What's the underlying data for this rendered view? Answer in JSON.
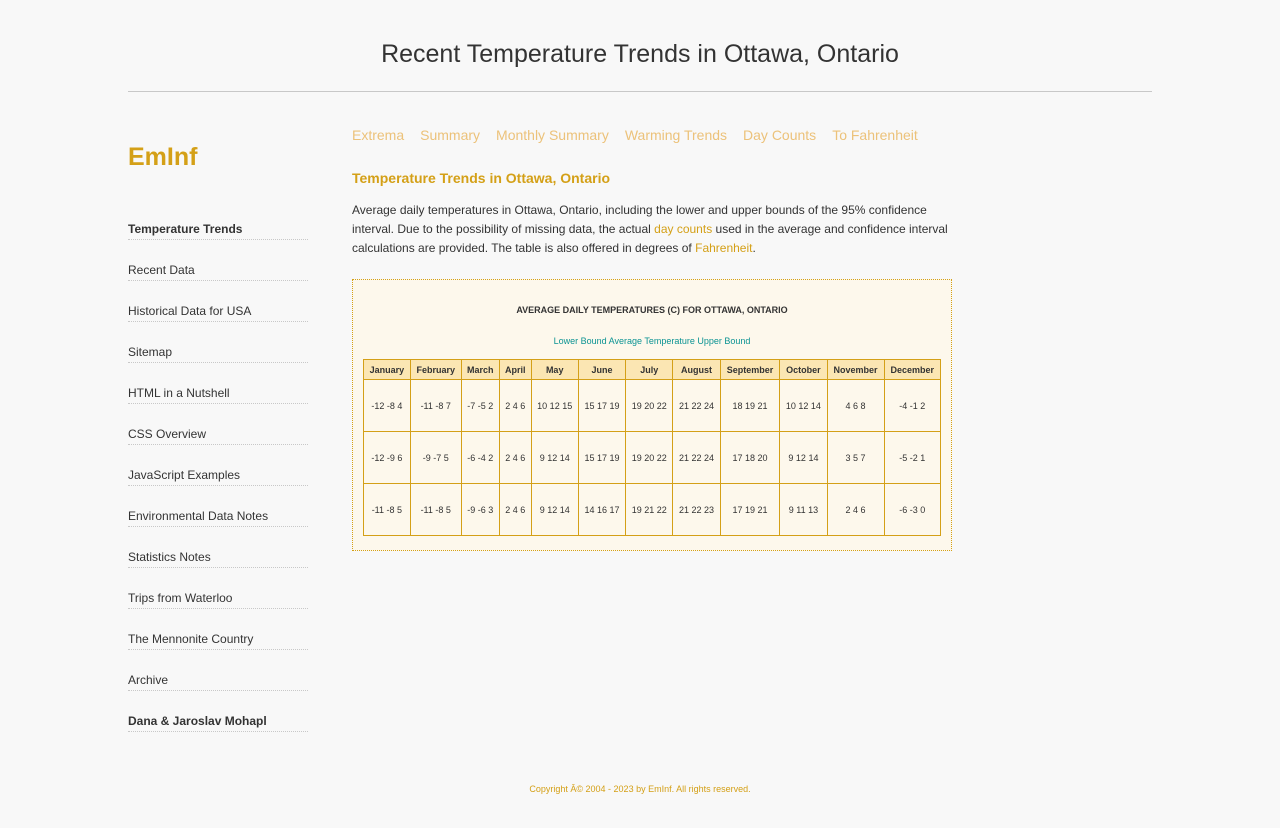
{
  "page_title": "Recent Temperature Trends in Ottawa, Ontario",
  "logo": "EmInf",
  "sidebar": {
    "items": [
      {
        "label": "Temperature Trends",
        "bold": true
      },
      {
        "label": "Recent Data",
        "bold": false
      },
      {
        "label": "Historical Data for USA",
        "bold": false
      },
      {
        "label": "Sitemap",
        "bold": false
      },
      {
        "label": "HTML in a Nutshell",
        "bold": false
      },
      {
        "label": "CSS Overview",
        "bold": false
      },
      {
        "label": "JavaScript Examples",
        "bold": false
      },
      {
        "label": "Environmental Data Notes",
        "bold": false
      },
      {
        "label": "Statistics Notes",
        "bold": false
      },
      {
        "label": "Trips from Waterloo",
        "bold": false
      },
      {
        "label": "The Mennonite Country",
        "bold": false
      },
      {
        "label": "Archive",
        "bold": false
      },
      {
        "label": "Dana & Jaroslav Mohapl",
        "bold": true
      }
    ]
  },
  "topnav": {
    "items": [
      "Extrema",
      "Summary",
      "Monthly Summary",
      "Warming Trends",
      "Day Counts",
      "To Fahrenheit"
    ]
  },
  "main": {
    "heading": "Temperature Trends in Ottawa, Ontario",
    "intro_part1": "Average daily temperatures in Ottawa, Ontario, including the lower and upper bounds of the 95% confidence interval. Due to the possibility of missing data, the actual ",
    "intro_link1": "day counts",
    "intro_part2": " used in the average and confidence interval calculations are provided. The table is also offered in degrees of ",
    "intro_link2": "Fahrenheit",
    "intro_part3": "."
  },
  "table": {
    "caption": "AVERAGE DAILY TEMPERATURES (C) FOR OTTAWA, ONTARIO",
    "legend": "Lower Bound Average Temperature Upper Bound",
    "headers": [
      "January",
      "February",
      "March",
      "April",
      "May",
      "June",
      "July",
      "August",
      "September",
      "October",
      "November",
      "December"
    ],
    "rows": [
      [
        "-12 -8 4",
        "-11 -8 7",
        "-7 -5 2",
        "2 4 6",
        "10 12 15",
        "15 17 19",
        "19 20 22",
        "21 22 24",
        "18 19 21",
        "10 12 14",
        "4 6 8",
        "-4 -1 2"
      ],
      [
        "-12 -9 6",
        "-9 -7 5",
        "-6 -4 2",
        "2 4 6",
        "9 12 14",
        "15 17 19",
        "19 20 22",
        "21 22 24",
        "17 18 20",
        "9 12 14",
        "3 5 7",
        "-5 -2 1"
      ],
      [
        "-11 -8 5",
        "-11 -8 5",
        "-9 -6 3",
        "2 4 6",
        "9 12 14",
        "14 16 17",
        "19 21 22",
        "21 22 23",
        "17 19 21",
        "9 11 13",
        "2 4 6",
        "-6 -3 0"
      ]
    ]
  },
  "footer": "Copyright Â© 2004 - 2023 by EmInf. All rights reserved."
}
